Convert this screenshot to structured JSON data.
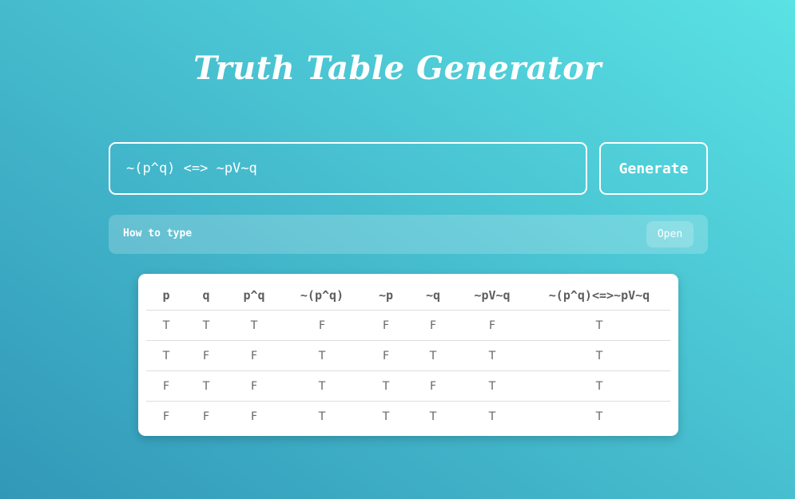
{
  "title": "Truth Table Generator",
  "expression_input": {
    "value": "~(p^q) <=> ~pV~q",
    "placeholder": ""
  },
  "generate_button": {
    "label": "Generate"
  },
  "how_to": {
    "label": "How to type",
    "open_label": "Open"
  },
  "truth_table": {
    "headers": [
      "p",
      "q",
      "p^q",
      "~(p^q)",
      "~p",
      "~q",
      "~pV~q",
      "~(p^q)<=>~pV~q"
    ],
    "rows": [
      [
        "T",
        "T",
        "T",
        "F",
        "F",
        "F",
        "F",
        "T"
      ],
      [
        "T",
        "F",
        "F",
        "T",
        "F",
        "T",
        "T",
        "T"
      ],
      [
        "F",
        "T",
        "F",
        "T",
        "T",
        "F",
        "T",
        "T"
      ],
      [
        "F",
        "F",
        "F",
        "T",
        "T",
        "T",
        "T",
        "T"
      ]
    ]
  },
  "colors": {
    "background_start": "#3298b8",
    "background_end": "#5ae2e4",
    "text_on_background": "#ffffff",
    "table_text": "#5e5e5e"
  }
}
